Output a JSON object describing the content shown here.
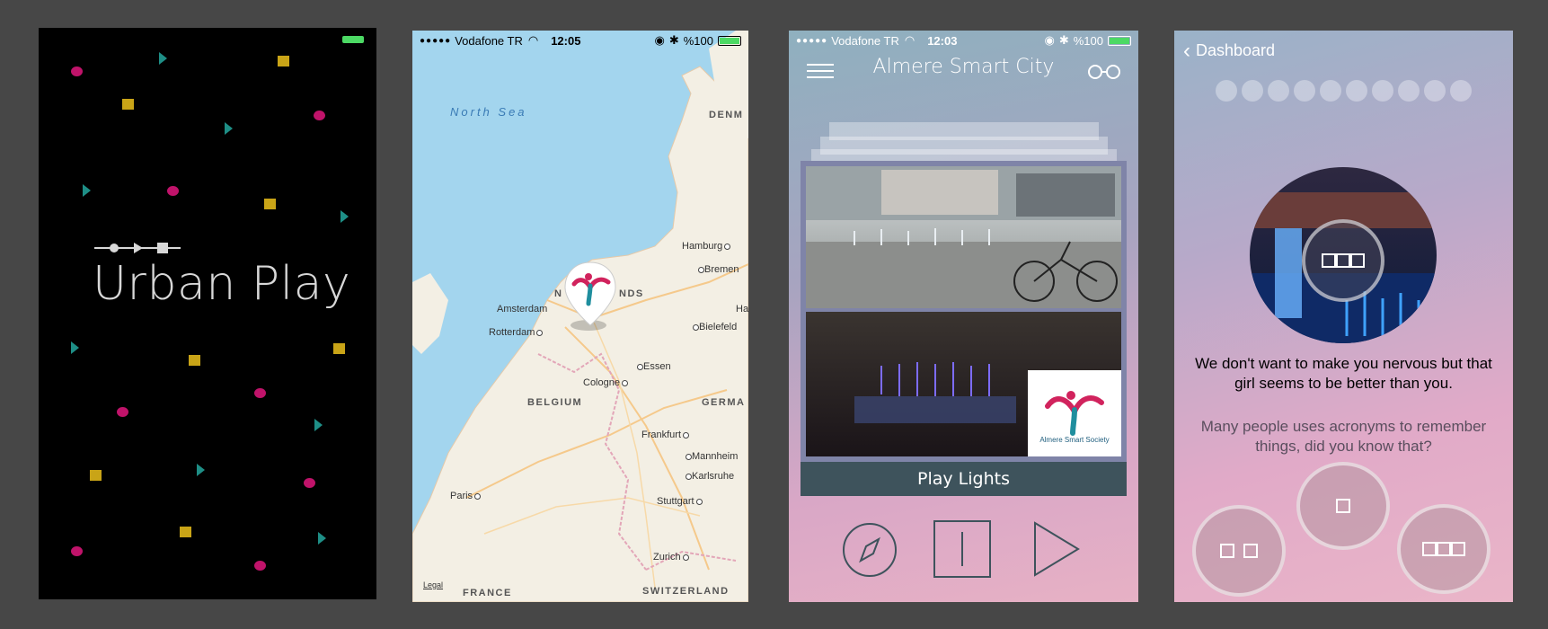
{
  "splash": {
    "title": "Urban Play"
  },
  "map": {
    "status": {
      "carrier": "Vodafone TR",
      "time": "12:05",
      "battery": "%100"
    },
    "labels": {
      "sea": "North Sea",
      "denmark": "DENM",
      "hamburg": "Hamburg",
      "bremen": "Bremen",
      "amsterdam": "Amsterdam",
      "netherlands_a": "N",
      "netherlands_b": "NDS",
      "rotterdam": "Rotterdam",
      "bielefeld": "Bielefeld",
      "ha": "Ha",
      "essen": "Essen",
      "cologne": "Cologne",
      "belgium": "BELGIUM",
      "germany": "GERMA",
      "frankfurt": "Frankfurt",
      "mannheim": "Mannheim",
      "karlsruhe": "Karlsruhe",
      "paris": "Paris",
      "stuttgart": "Stuttgart",
      "zurich": "Zurich",
      "france": "FRANCE",
      "switzerland": "SWITZERLAND",
      "legal": "Legal"
    }
  },
  "detail": {
    "status": {
      "carrier": "Vodafone TR",
      "time": "12:03",
      "battery": "%100"
    },
    "title": "Almere Smart City",
    "caption": "Play Lights",
    "logo_text": "Almere Smart Society"
  },
  "quiz": {
    "back_label": "Dashboard",
    "message": "We don't want to make you nervous but that girl seems to be better than you.",
    "hint": "Many people uses acronyms to remember things, did you know that?"
  },
  "colors": {
    "dot": "#c0136a",
    "square": "#c9a417",
    "triangle": "#1e8e86",
    "caption_bar": "#3e535c"
  }
}
